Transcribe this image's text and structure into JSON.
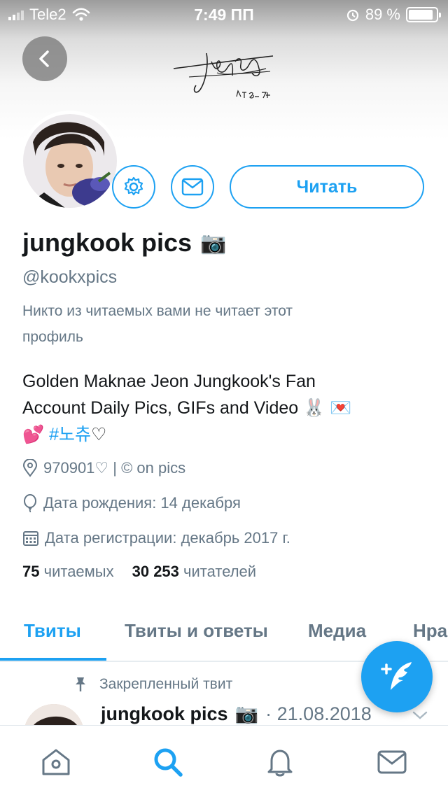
{
  "status_bar": {
    "carrier": "Tele2",
    "time": "7:49 ПП",
    "battery": "89 %",
    "battery_level": 0.89
  },
  "profile": {
    "name": "jungkook pics",
    "name_emoji": "📷",
    "handle": "@kookxpics",
    "follow_note": "Никто из читаемых вами не читает этот профиль",
    "bio_line1": "Golden Maknae Jeon Jungkook's Fan",
    "bio_line2": "Account Daily Pics, GIFs and Video",
    "bio_emoji2": "🐰 💌",
    "bio_emoji3": "💕",
    "bio_hashtag": "#노츄",
    "bio_heart": "♡",
    "location": "970901♡ | © on pics",
    "birthday": "Дата рождения: 14 декабря",
    "joined": "Дата регистрации: декабрь 2017 г.",
    "following_count": "75",
    "following_label": "читаемых",
    "followers_count": "30 253",
    "followers_label": "читателей",
    "follow_button": "Читать"
  },
  "tabs": [
    "Твиты",
    "Твиты и ответы",
    "Медиа",
    "Нра"
  ],
  "pinned": {
    "label": "Закрепленный твит",
    "name": "jungkook pics",
    "emoji": "📷",
    "date": "· 21.08.2018"
  },
  "colors": {
    "accent": "#1da1f2",
    "muted": "#657786",
    "text": "#14171a"
  },
  "icons": {
    "back": "chevron-left-icon",
    "settings": "gear-icon",
    "message": "envelope-icon",
    "compose": "compose-feather-icon",
    "nav": [
      "home-icon",
      "search-icon",
      "bell-icon",
      "mail-icon"
    ]
  }
}
